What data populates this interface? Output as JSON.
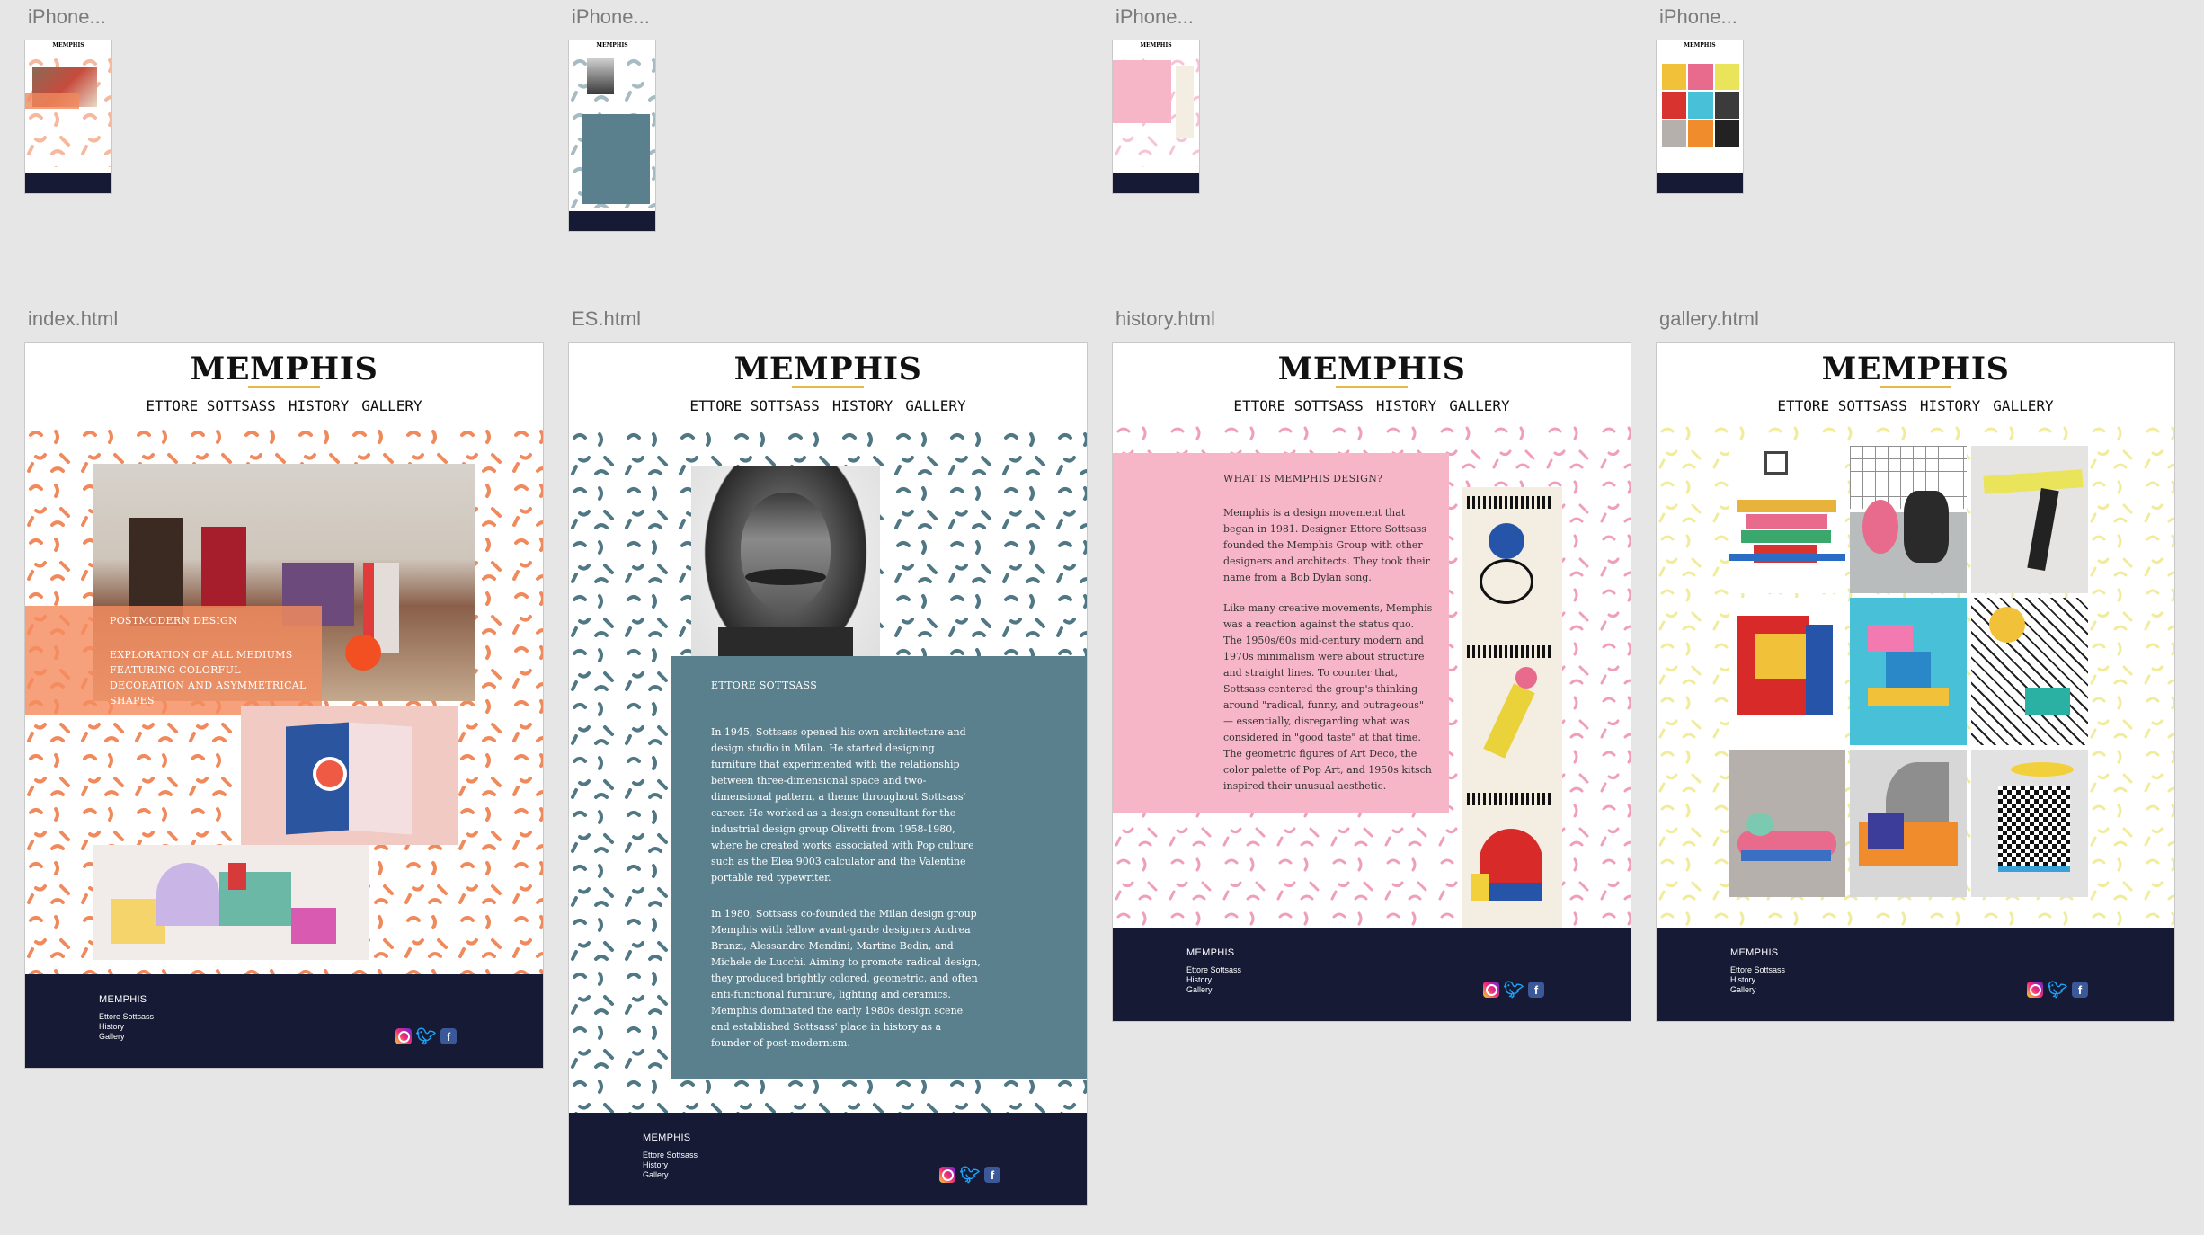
{
  "thumbnails": [
    {
      "label": "iPhone..."
    },
    {
      "label": "iPhone..."
    },
    {
      "label": "iPhone..."
    },
    {
      "label": "iPhone..."
    }
  ],
  "artboards": [
    {
      "label": "index.html"
    },
    {
      "label": "ES.html"
    },
    {
      "label": "history.html"
    },
    {
      "label": "gallery.html"
    }
  ],
  "site": {
    "title": "MEMPHIS",
    "nav": [
      "ETTORE SOTTSASS",
      "HISTORY",
      "GALLERY"
    ]
  },
  "footer": {
    "brand": "MEMPHIS",
    "links": [
      "Ettore Sottsass",
      "History",
      "Gallery"
    ],
    "social_icons": [
      "instagram-icon",
      "twitter-icon",
      "facebook-icon"
    ]
  },
  "index": {
    "heading": "POSTMODERN DESIGN",
    "subheading": "EXPLORATION OF ALL MEDIUMS FEATURING COLORFUL DECORATION AND ASYMMETRICAL SHAPES",
    "pattern_color": "#f08a5d"
  },
  "es": {
    "caption": "ETTORE SOTTSASS",
    "para1": "In 1945, Sottsass opened his own architecture and design studio in Milan. He started designing furniture that experimented with the relationship between three-dimensional space and two-dimensional pattern, a theme throughout Sottsass' career. He worked as a design consultant for the industrial design group Olivetti from 1958-1980, where he created works associated with Pop culture such as the Elea 9003 calculator and the Valentine portable red typewriter.",
    "para2": "In 1980, Sottsass co-founded the Milan design group Memphis with fellow avant-garde designers Andrea Branzi, Alessandro Mendini, Martine Bedin, and Michele de Lucchi. Aiming to promote radical design, they produced brightly colored, geometric, and often anti-functional furniture, lighting and ceramics. Memphis dominated the early 1980s design scene and established Sottsass' place in history as a founder of post-modernism.",
    "panel_color": "#5a7f8d",
    "pattern_color": "#4f7784"
  },
  "history": {
    "heading": "WHAT IS MEMPHIS DESIGN?",
    "para1": "Memphis is a design movement that began in 1981. Designer Ettore Sottsass founded the Memphis Group with other designers and architects. They took their name from a Bob Dylan song.",
    "para2": "Like many creative movements, Memphis was a reaction against the status quo. The 1950s/60s mid-century modern and 1970s minimalism were about structure and straight lines. To counter that, Sottsass centered the group's thinking around \"radical, funny, and outrageous\" — essentially, disregarding what was considered in \"good taste\" at that time. The geometric figures of Art Deco, the color palette of Pop Art, and 1950s kitsch inspired their unusual aesthetic.",
    "panel_color": "#f6b6c8",
    "pattern_color": "#ef9fbc"
  },
  "gallery": {
    "pattern_color": "#f1ec9a"
  },
  "colors": {
    "footer": "#161a35",
    "accent_rule": "#e7b949",
    "canvas": "#e6e6e6"
  }
}
